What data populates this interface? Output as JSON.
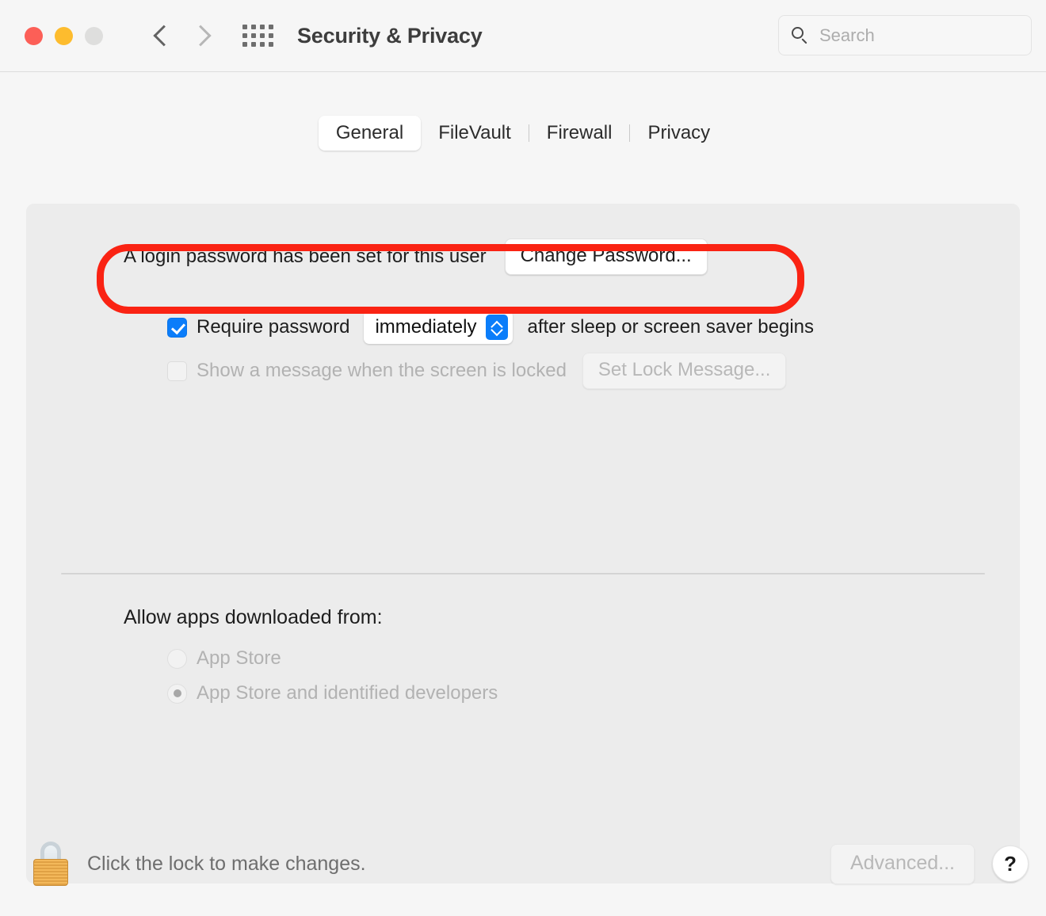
{
  "toolbar": {
    "title": "Security & Privacy",
    "back_label": "Back",
    "forward_label": "Forward",
    "grid_label": "Show All",
    "search": {
      "placeholder": "Search",
      "value": ""
    }
  },
  "tabs": [
    {
      "label": "General",
      "active": true
    },
    {
      "label": "FileVault",
      "active": false
    },
    {
      "label": "Firewall",
      "active": false
    },
    {
      "label": "Privacy",
      "active": false
    }
  ],
  "general": {
    "password_status": "A login password has been set for this user",
    "change_password_button": "Change Password...",
    "require_password": {
      "checked": true,
      "label": "Require password",
      "interval_value": "immediately",
      "suffix": "after sleep or screen saver begins"
    },
    "lock_message": {
      "checked": false,
      "label": "Show a message when the screen is locked",
      "button": "Set Lock Message...",
      "disabled": true
    },
    "allow_apps": {
      "label": "Allow apps downloaded from:",
      "options": [
        {
          "label": "App Store",
          "selected": false,
          "disabled": true
        },
        {
          "label": "App Store and identified developers",
          "selected": true,
          "disabled": true
        }
      ]
    }
  },
  "bottom": {
    "lock_text": "Click the lock to make changes.",
    "advanced_button": "Advanced...",
    "help_button": "?"
  },
  "annotation": {
    "color": "#fa2313",
    "target": "A login password has been set for this user"
  }
}
